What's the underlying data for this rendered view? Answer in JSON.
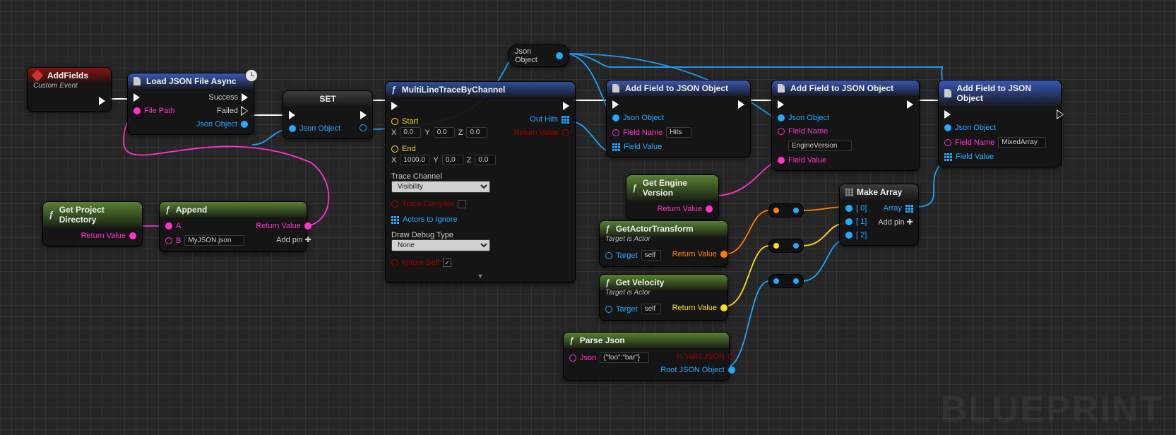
{
  "watermark": "BLUEPRINT",
  "nodes": {
    "addfields": {
      "title": "AddFields",
      "subtitle": "Custom Event"
    },
    "loadjson": {
      "title": "Load JSON File Async",
      "in_file": "File Path",
      "out_success": "Success",
      "out_failed": "Failed",
      "out_obj": "Json Object"
    },
    "set": {
      "title": "SET",
      "pin": "Json Object"
    },
    "projdir": {
      "title": "Get Project Directory",
      "out": "Return Value"
    },
    "append": {
      "title": "Append",
      "inA": "A",
      "inB": "B",
      "bval": "MyJSON.json",
      "out": "Return Value",
      "addpin": "Add pin"
    },
    "trace": {
      "title": "MultiLineTraceByChannel",
      "start": "Start",
      "sx": "0.0",
      "sy": "0.0",
      "sz": "0.0",
      "end": "End",
      "ex": "1000.0",
      "ey": "0.0",
      "ez": "0.0",
      "channel_lbl": "Trace Channel",
      "channel_val": "Visibility",
      "complex": "Trace Complex",
      "ignore": "Actors to Ignore",
      "debug_lbl": "Draw Debug Type",
      "debug_val": "None",
      "ignoreself": "Ignore Self",
      "ignoreself_checked": "✓",
      "out_hits": "Out Hits",
      "out_ret": "Return Value"
    },
    "jsonobj_reroute_label": "Json Object",
    "addfield1": {
      "title": "Add Field to JSON Object",
      "jo": "Json Object",
      "fn": "Field Name",
      "fn_val": "Hits",
      "fv": "Field Value"
    },
    "addfield2": {
      "title": "Add Field to JSON Object",
      "jo": "Json Object",
      "fn": "Field Name",
      "fn_val": "EngineVersion",
      "fv": "Field Value"
    },
    "addfield3": {
      "title": "Add Field to JSON Object",
      "jo": "Json Object",
      "fn": "Field Name",
      "fn_val": "MixedArray",
      "fv": "Field Value"
    },
    "enginever": {
      "title": "Get Engine Version",
      "out": "Return Value"
    },
    "actortrans": {
      "title": "GetActorTransform",
      "sub": "Target is Actor",
      "target": "Target",
      "tval": "self",
      "out": "Return Value"
    },
    "velocity": {
      "title": "Get Velocity",
      "sub": "Target is Actor",
      "target": "Target",
      "tval": "self",
      "out": "Return Value"
    },
    "parsejson": {
      "title": "Parse Json",
      "in": "Json",
      "inval": "{\"foo\":\"bar\"}",
      "valid": "Is Valid JSON",
      "root": "Root JSON Object"
    },
    "makearray": {
      "title": "Make Array",
      "i0": "[ 0]",
      "i1": "[ 1]",
      "i2": "[ 2]",
      "out": "Array",
      "addpin": "Add pin"
    }
  }
}
